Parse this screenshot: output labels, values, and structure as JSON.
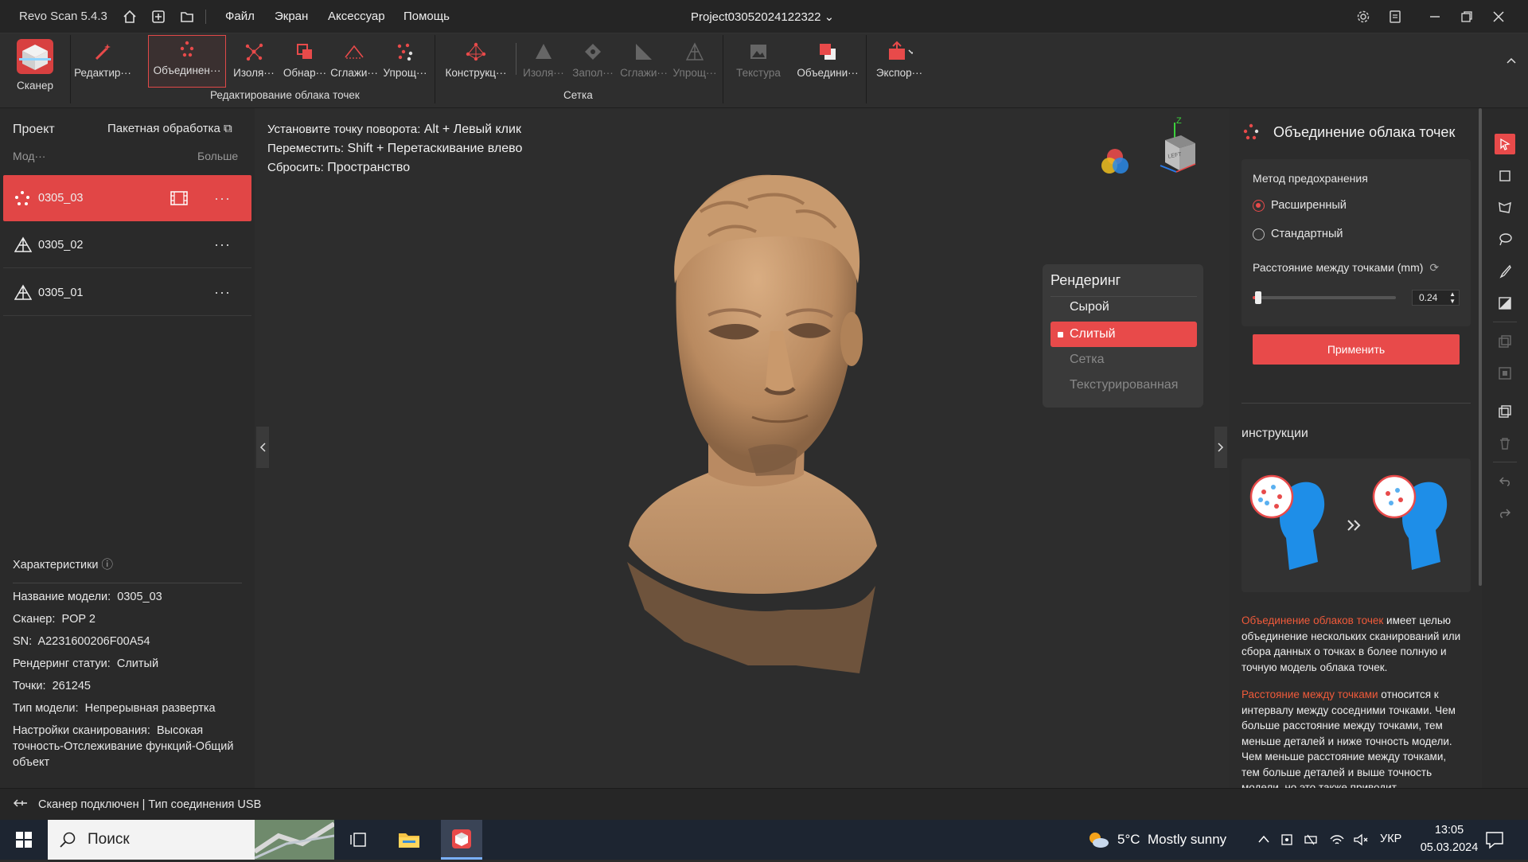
{
  "title_bar": {
    "app_name": "Revo Scan 5.4.3",
    "menus": [
      "Файл",
      "Экран",
      "Аксессуар",
      "Помощь"
    ],
    "project_title": "Project03052024122322"
  },
  "ribbon": {
    "scanner_label": "Сканер",
    "point_cloud_tools": [
      "Редактир···",
      "Объединен···",
      "Изоля···",
      "Обнар···",
      "Сглажи···",
      "Упрощ···"
    ],
    "point_cloud_group": "Редактирование облака точек",
    "mesh_tools": [
      "Конструкц···",
      "Изоля···",
      "Запол···",
      "Сглажи···",
      "Упрощ···"
    ],
    "mesh_group": "Сетка",
    "texture_label": "Текстура",
    "merge_label": "Объедини···",
    "export_label": "Экспор···"
  },
  "left_panel": {
    "project_label": "Проект",
    "batch_label": "Пакетная обработка",
    "model_col": "Мод···",
    "more_col": "Больше",
    "items": [
      {
        "name": "0305_03",
        "selected": true
      },
      {
        "name": "0305_02",
        "selected": false
      },
      {
        "name": "0305_01",
        "selected": false
      }
    ],
    "characteristics_label": "Характеристики",
    "info": [
      {
        "key": "Название модели:",
        "value": "0305_03"
      },
      {
        "key": "Сканер:",
        "value": "POP 2"
      },
      {
        "key": "SN:",
        "value": "A2231600206F00A54"
      },
      {
        "key": "Рендеринг статуи:",
        "value": "Слитый"
      },
      {
        "key": "Точки:",
        "value": "261245"
      },
      {
        "key": "Тип модели:",
        "value": "Непрерывная развертка"
      },
      {
        "key": "Настройки сканирования:",
        "value": "Высокая точность-Отслеживание функций-Общий объект"
      }
    ]
  },
  "viewport": {
    "hints": [
      {
        "label": "Установите точку поворота:",
        "value": "Alt + Левый клик"
      },
      {
        "label": "Переместить:",
        "value": "Shift + Перетаскивание влево"
      },
      {
        "label": "Сбросить:",
        "value": "Пространство"
      }
    ],
    "axis_label": "Z",
    "cube_label": "LEFT",
    "render_panel": {
      "title": "Рендеринг",
      "options": [
        "Сырой",
        "Слитый",
        "Сетка",
        "Текстурированная"
      ],
      "selected": "Слитый"
    }
  },
  "right_panel": {
    "title": "Объединение облака точек",
    "method_label": "Метод предохранения",
    "options": [
      "Расширенный",
      "Стандартный"
    ],
    "selected_option": "Расширенный",
    "distance_label": "Расстояние между точками (mm)",
    "distance_value": "0.24",
    "slider_level": 0.03,
    "apply_label": "Применить",
    "instructions_label": "инструкции",
    "desc1_hl": "Объединение облаков точек",
    "desc1": " имеет целью объединение нескольких сканирований или сбора данных о точках в более полную и точную модель облака точек.",
    "desc2_hl": "Расстояние между точками",
    "desc2": " относится к интервалу между соседними точками. Чем больше расстояние между точками, тем меньше деталей и ниже точность модели. Чем меньше расстояние между точками, тем больше деталей и выше точность модели, но это также приводит"
  },
  "status_bar": {
    "text": "Сканер подключен | Тип соединения USB"
  },
  "taskbar": {
    "search": "Поиск",
    "weather": "5°C  Mostly sunny",
    "lang": "УКР",
    "time": "13:05",
    "date": "05.03.2024"
  },
  "colors": {
    "accent": "#e84a4a",
    "highlight_text": "#f05a3a",
    "bust": "#c89a70"
  }
}
